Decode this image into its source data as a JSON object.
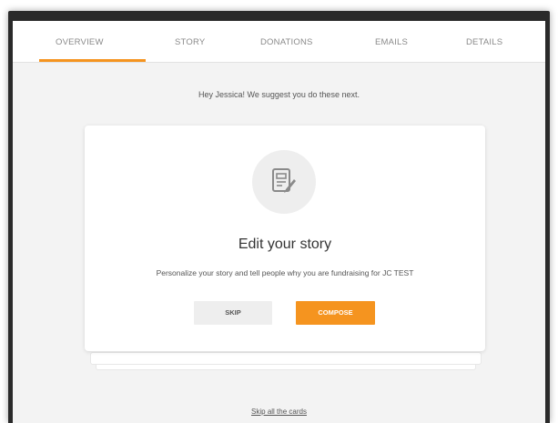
{
  "tabs": [
    {
      "label": "OVERVIEW",
      "active": true
    },
    {
      "label": "STORY",
      "active": false
    },
    {
      "label": "DONATIONS",
      "active": false
    },
    {
      "label": "EMAILS",
      "active": false
    },
    {
      "label": "DETAILS",
      "active": false
    }
  ],
  "accent_color": "#f5941f",
  "suggestion_text": "Hey Jessica! We suggest you do these next.",
  "card": {
    "icon": "edit-document-icon",
    "title": "Edit your story",
    "description": "Personalize your story and tell people why you are fundraising for JC TEST",
    "skip_label": "SKIP",
    "compose_label": "COMPOSE"
  },
  "skip_all_label": "Skip all the cards"
}
